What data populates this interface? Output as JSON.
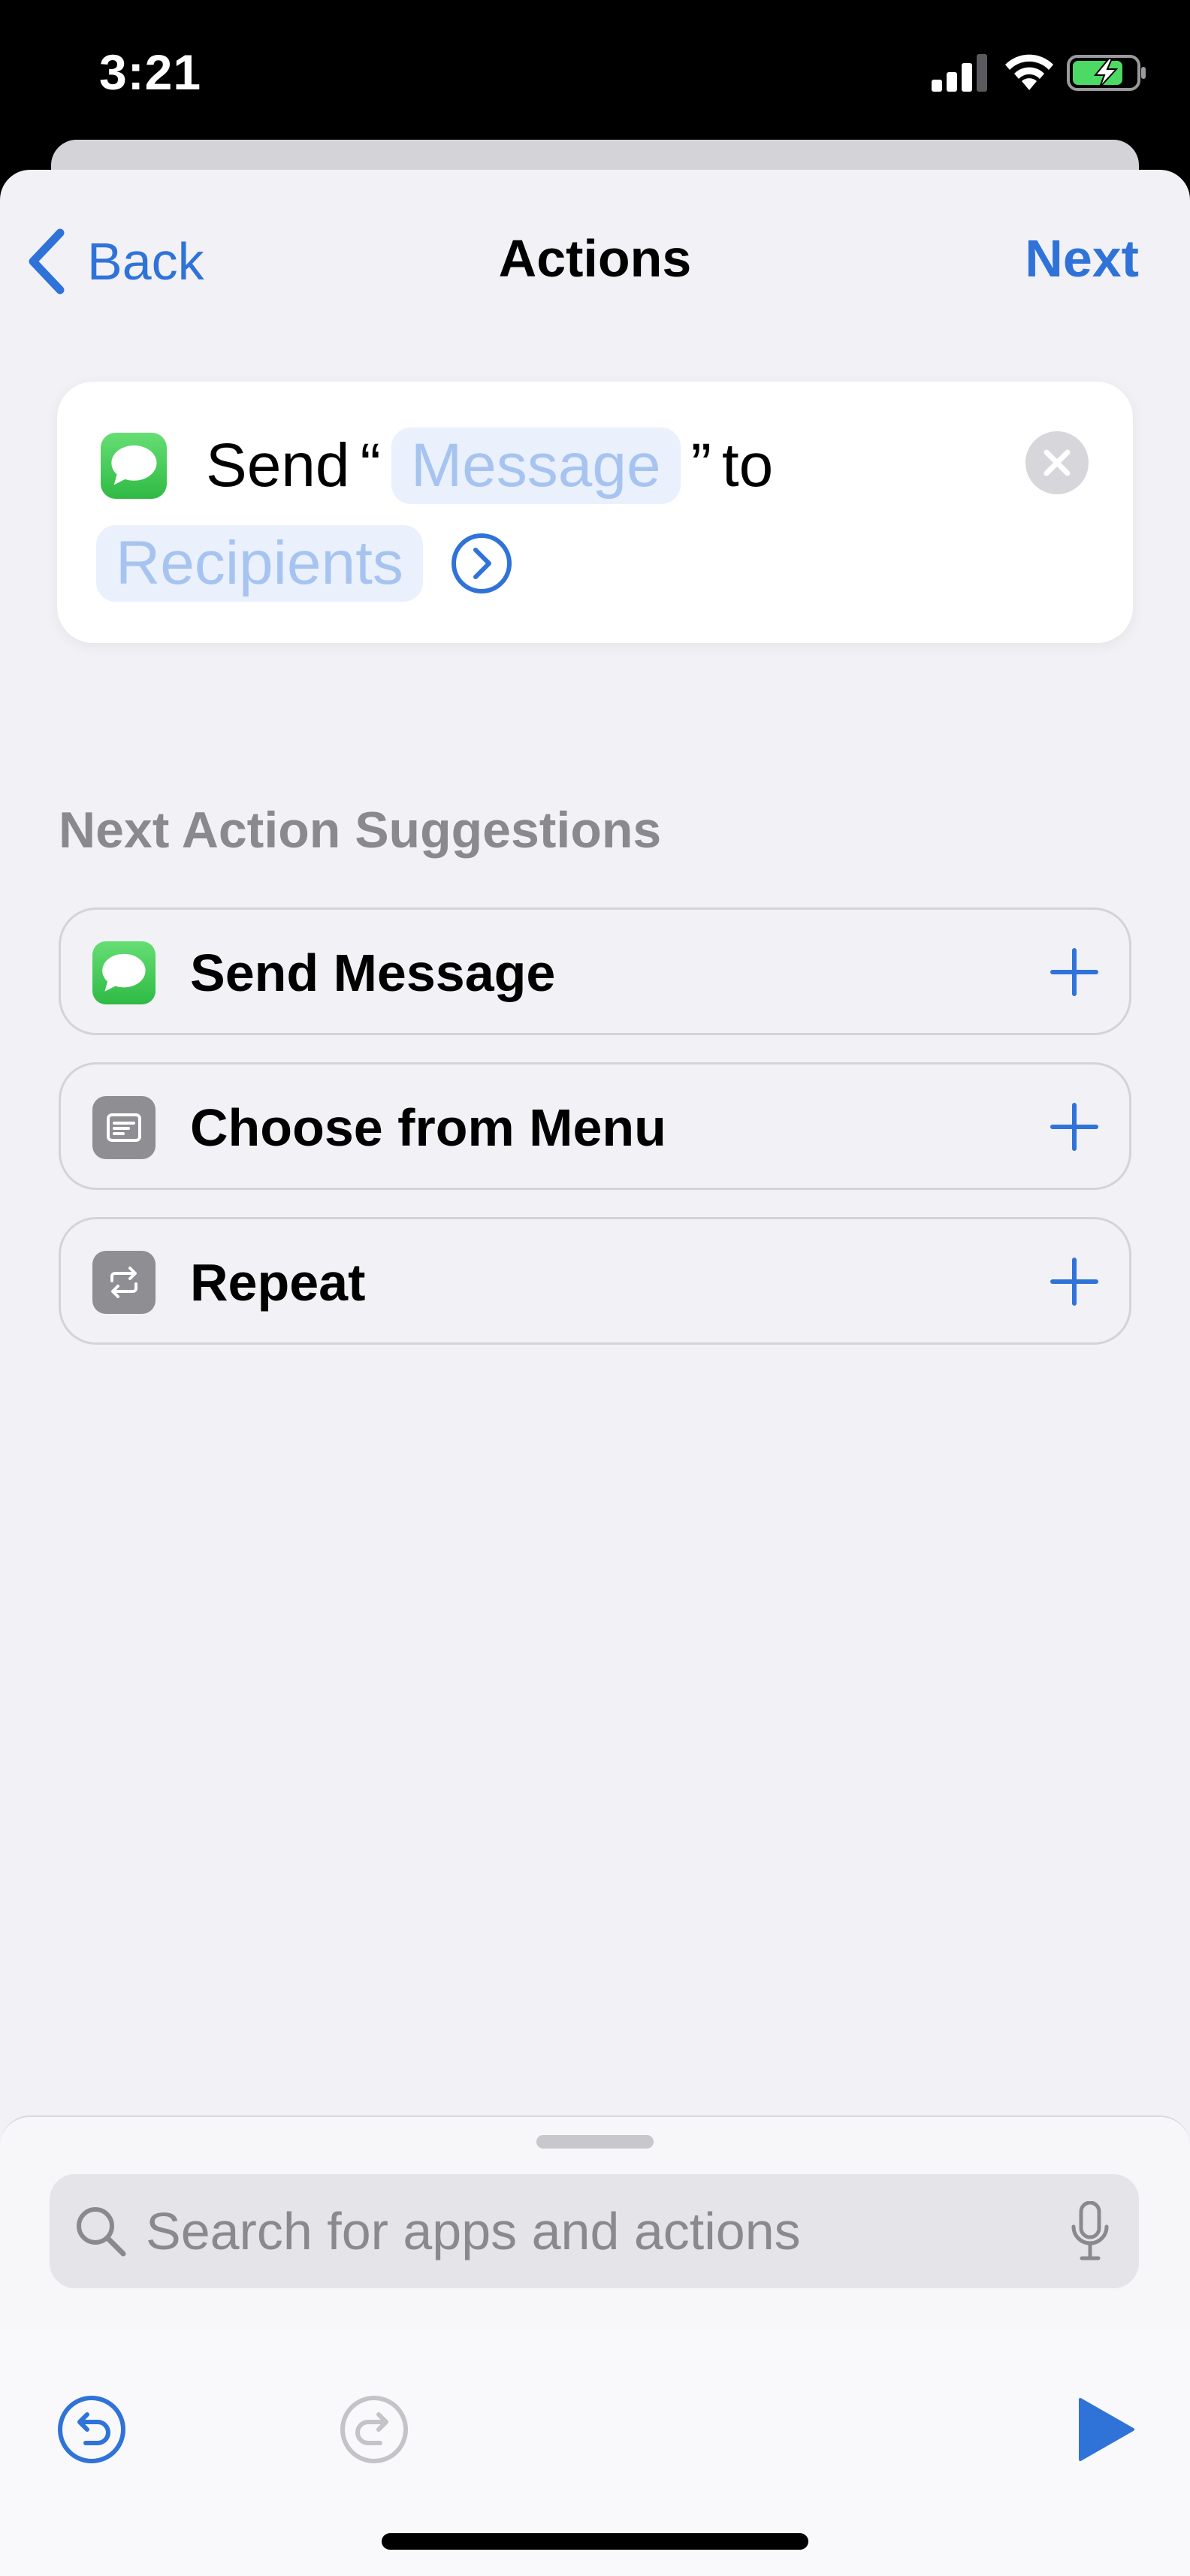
{
  "status_bar": {
    "time": "3:21"
  },
  "nav": {
    "back_label": "Back",
    "title": "Actions",
    "next_label": "Next"
  },
  "action_card": {
    "send_word": "Send",
    "open_quote": "“",
    "message_token": "Message",
    "close_quote": "”",
    "to_word": "to",
    "recipients_token": "Recipients"
  },
  "suggestions": {
    "header": "Next Action Suggestions",
    "items": [
      {
        "label": "Send Message",
        "icon": "messages-icon"
      },
      {
        "label": "Choose from Menu",
        "icon": "menu-icon"
      },
      {
        "label": "Repeat",
        "icon": "repeat-icon"
      }
    ]
  },
  "search": {
    "placeholder": "Search for apps and actions"
  },
  "colors": {
    "accent": "#2f73d9",
    "background": "#f1f1f6",
    "battery": "#4cd964",
    "messages_green": "#34c759"
  }
}
